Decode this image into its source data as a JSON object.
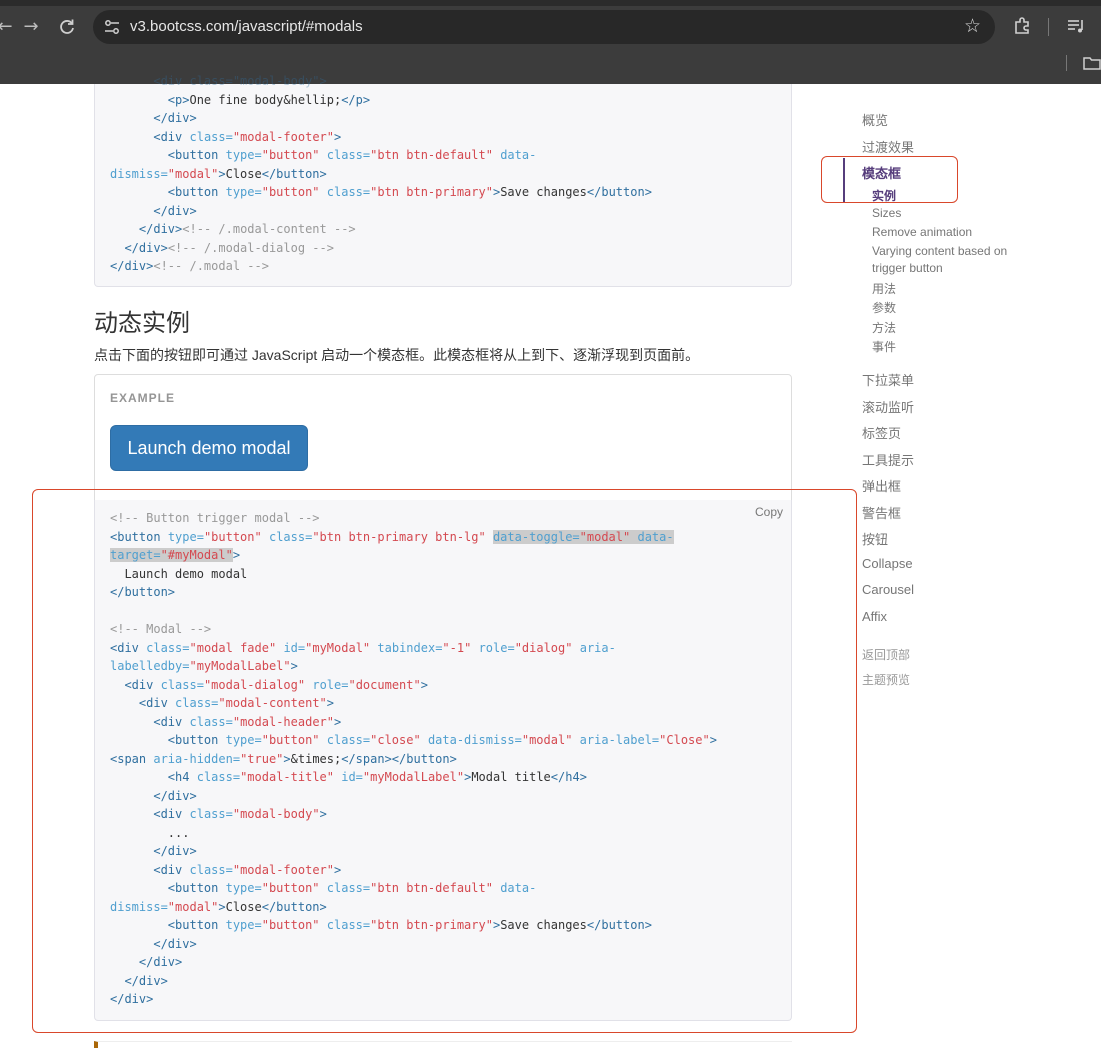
{
  "browser": {
    "url": "v3.bootcss.com/javascript/#modals"
  },
  "top_code_lines": [
    "      <div class=\"modal-body\">",
    "        <p>One fine body&hellip;</p>",
    "      </div>",
    "      <div class=\"modal-footer\">",
    "        <button type=\"button\" class=\"btn btn-default\" data-",
    "dismiss=\"modal\">Close</button>",
    "        <button type=\"button\" class=\"btn btn-primary\">Save changes</button>",
    "      </div>",
    "    </div><!-- /.modal-content -->",
    "  </div><!-- /.modal-dialog -->",
    "</div><!-- /.modal -->"
  ],
  "section": {
    "title": "动态实例",
    "description": "点击下面的按钮即可通过 JavaScript 启动一个模态框。此模态框将从上到下、逐渐浮现到页面前。"
  },
  "example": {
    "label": "EXAMPLE",
    "button_label": "Launch demo modal"
  },
  "code": {
    "copy_label": "Copy"
  },
  "sidebar": {
    "items_top": [
      {
        "label": "概览",
        "active": false
      },
      {
        "label": "过渡效果",
        "active": false
      },
      {
        "label": "模态框",
        "active": true
      }
    ],
    "sub_items": [
      {
        "label": "实例",
        "active": true
      },
      {
        "label": "Sizes",
        "active": false
      },
      {
        "label": "Remove animation",
        "active": false
      },
      {
        "label": "Varying content based on",
        "active": false
      },
      {
        "label": "trigger button",
        "active": false
      },
      {
        "label": "用法",
        "active": false
      },
      {
        "label": "参数",
        "active": false
      },
      {
        "label": "方法",
        "active": false
      },
      {
        "label": "事件",
        "active": false
      }
    ],
    "items_bottom": [
      {
        "label": "下拉菜单"
      },
      {
        "label": "滚动监听"
      },
      {
        "label": "标签页"
      },
      {
        "label": "工具提示"
      },
      {
        "label": "弹出框"
      },
      {
        "label": "警告框"
      },
      {
        "label": "按钮"
      },
      {
        "label": "Collapse"
      },
      {
        "label": "Carousel"
      },
      {
        "label": "Affix"
      }
    ],
    "footer_links": [
      {
        "label": "返回顶部"
      },
      {
        "label": "主题预览"
      }
    ]
  },
  "colors": {
    "annotation": "#d9472b",
    "primary_button": "#337ab7",
    "nav_active": "#563d7c"
  }
}
